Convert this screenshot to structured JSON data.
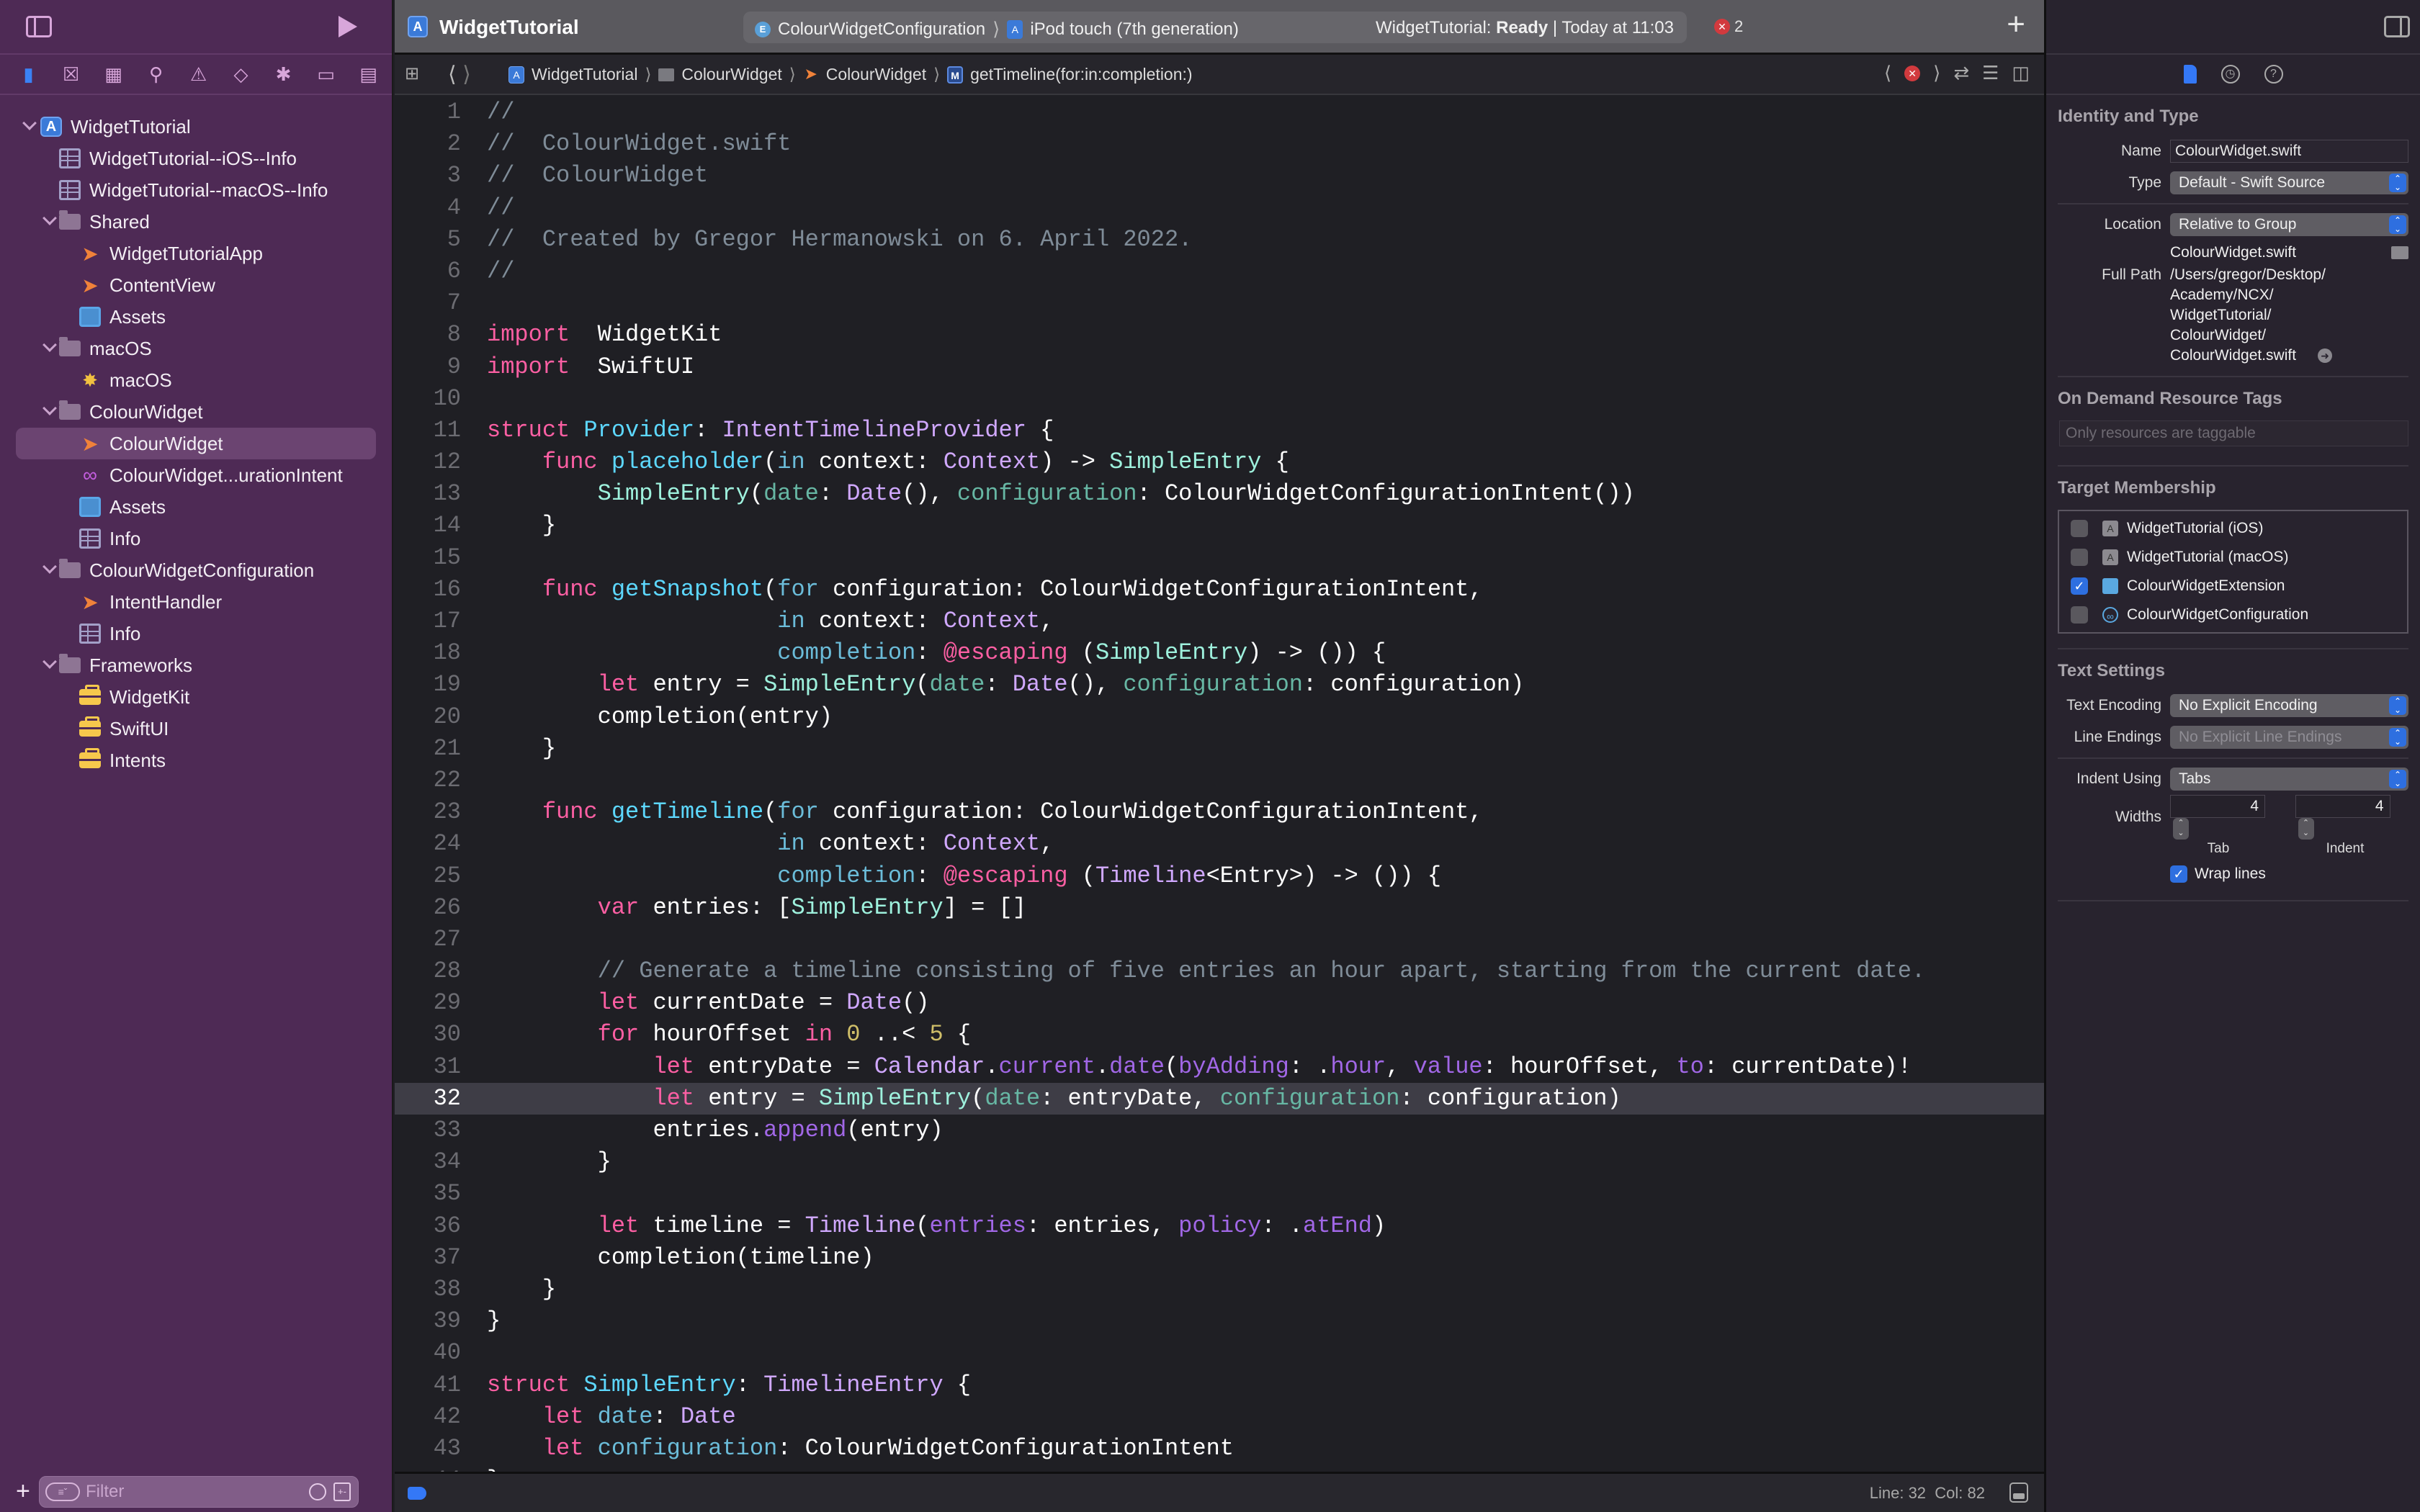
{
  "navigator": {
    "tabs": [
      "project-navigator",
      "source-control-navigator",
      "symbol-navigator",
      "find-navigator",
      "issue-navigator",
      "test-navigator",
      "debug-navigator",
      "breakpoint-navigator",
      "report-navigator"
    ],
    "tree": [
      {
        "label": "WidgetTutorial",
        "icon": "project-icon",
        "depth": 0,
        "expanded": true
      },
      {
        "label": "WidgetTutorial--iOS--Info",
        "icon": "plist-icon",
        "depth": 1
      },
      {
        "label": "WidgetTutorial--macOS--Info",
        "icon": "plist-icon",
        "depth": 1
      },
      {
        "label": "Shared",
        "icon": "folder-icon",
        "depth": 1,
        "expanded": true
      },
      {
        "label": "WidgetTutorialApp",
        "icon": "swift-file-icon",
        "depth": 2
      },
      {
        "label": "ContentView",
        "icon": "swift-file-icon",
        "depth": 2
      },
      {
        "label": "Assets",
        "icon": "asset-catalog-icon",
        "depth": 2
      },
      {
        "label": "macOS",
        "icon": "folder-icon",
        "depth": 1,
        "expanded": true
      },
      {
        "label": "macOS",
        "icon": "entitlements-icon",
        "depth": 2
      },
      {
        "label": "ColourWidget",
        "icon": "folder-icon",
        "depth": 1,
        "expanded": true
      },
      {
        "label": "ColourWidget",
        "icon": "swift-file-icon",
        "depth": 2,
        "selected": true
      },
      {
        "label": "ColourWidget...urationIntent",
        "icon": "intent-definition-icon",
        "depth": 2
      },
      {
        "label": "Assets",
        "icon": "asset-catalog-icon",
        "depth": 2
      },
      {
        "label": "Info",
        "icon": "plist-icon",
        "depth": 2
      },
      {
        "label": "ColourWidgetConfiguration",
        "icon": "folder-icon",
        "depth": 1,
        "expanded": true
      },
      {
        "label": "IntentHandler",
        "icon": "swift-file-icon",
        "depth": 2
      },
      {
        "label": "Info",
        "icon": "plist-icon",
        "depth": 2
      },
      {
        "label": "Frameworks",
        "icon": "folder-icon",
        "depth": 1,
        "expanded": true
      },
      {
        "label": "WidgetKit",
        "icon": "framework-icon",
        "depth": 2
      },
      {
        "label": "SwiftUI",
        "icon": "framework-icon",
        "depth": 2
      },
      {
        "label": "Intents",
        "icon": "framework-icon",
        "depth": 2
      }
    ],
    "filter_placeholder": "Filter"
  },
  "toolbar": {
    "project_title": "WidgetTutorial",
    "scheme": "ColourWidgetConfiguration",
    "destination": "iPod touch (7th generation)",
    "status_prefix": "WidgetTutorial: ",
    "status_state": "Ready",
    "status_time": "| Today at 11:03",
    "error_count": "2"
  },
  "jumpbar": {
    "crumbs": [
      {
        "label": "WidgetTutorial",
        "icon": "project-icon"
      },
      {
        "label": "ColourWidget",
        "icon": "folder-icon"
      },
      {
        "label": "ColourWidget",
        "icon": "swift-file-icon"
      },
      {
        "label": "getTimeline(for:in:completion:)",
        "icon": "method-icon"
      }
    ]
  },
  "editor": {
    "current_line": 32,
    "lines": [
      [
        [
          "cm",
          "//"
        ]
      ],
      [
        [
          "cm",
          "//  ColourWidget.swift"
        ]
      ],
      [
        [
          "cm",
          "//  ColourWidget"
        ]
      ],
      [
        [
          "cm",
          "//"
        ]
      ],
      [
        [
          "cm",
          "//  Created by Gregor Hermanowski on 6. April 2022."
        ]
      ],
      [
        [
          "cm",
          "//"
        ]
      ],
      [],
      [
        [
          "kw",
          "import"
        ],
        [
          "",
          "  WidgetKit"
        ]
      ],
      [
        [
          "kw",
          "import"
        ],
        [
          "",
          "  SwiftUI"
        ]
      ],
      [],
      [
        [
          "kw",
          "struct"
        ],
        [
          "",
          " "
        ],
        [
          "decl",
          "Provider"
        ],
        [
          "",
          ": "
        ],
        [
          "type",
          "IntentTimelineProvider"
        ],
        [
          "",
          " {"
        ]
      ],
      [
        [
          "",
          "    "
        ],
        [
          "kw",
          "func"
        ],
        [
          "",
          " "
        ],
        [
          "decl",
          "placeholder"
        ],
        [
          "",
          "("
        ],
        [
          "lbl",
          "in"
        ],
        [
          "",
          " context: "
        ],
        [
          "type",
          "Context"
        ],
        [
          "",
          ") -> "
        ],
        [
          "proj",
          "SimpleEntry"
        ],
        [
          "",
          " {"
        ]
      ],
      [
        [
          "",
          "        "
        ],
        [
          "proj",
          "SimpleEntry"
        ],
        [
          "",
          "("
        ],
        [
          "param",
          "date"
        ],
        [
          "",
          ": "
        ],
        [
          "type",
          "Date"
        ],
        [
          "",
          "(), "
        ],
        [
          "param",
          "configuration"
        ],
        [
          "",
          ": ColourWidgetConfigurationIntent())"
        ]
      ],
      [
        [
          "",
          "    }"
        ]
      ],
      [],
      [
        [
          "",
          "    "
        ],
        [
          "kw",
          "func"
        ],
        [
          "",
          " "
        ],
        [
          "decl",
          "getSnapshot"
        ],
        [
          "",
          "("
        ],
        [
          "lbl",
          "for"
        ],
        [
          "",
          " configuration: ColourWidgetConfigurationIntent,"
        ]
      ],
      [
        [
          "",
          "                     "
        ],
        [
          "lbl",
          "in"
        ],
        [
          "",
          " context: "
        ],
        [
          "type",
          "Context"
        ],
        [
          "",
          ","
        ]
      ],
      [
        [
          "",
          "                     "
        ],
        [
          "lbl",
          "completion"
        ],
        [
          "",
          ": "
        ],
        [
          "kw",
          "@escaping"
        ],
        [
          "",
          " ("
        ],
        [
          "proj",
          "SimpleEntry"
        ],
        [
          "",
          ") -> ()) {"
        ]
      ],
      [
        [
          "",
          "        "
        ],
        [
          "kw",
          "let"
        ],
        [
          "",
          " entry = "
        ],
        [
          "proj",
          "SimpleEntry"
        ],
        [
          "",
          "("
        ],
        [
          "param",
          "date"
        ],
        [
          "",
          ": "
        ],
        [
          "type",
          "Date"
        ],
        [
          "",
          "(), "
        ],
        [
          "param",
          "configuration"
        ],
        [
          "",
          ": configuration)"
        ]
      ],
      [
        [
          "",
          "        completion(entry)"
        ]
      ],
      [
        [
          "",
          "    }"
        ]
      ],
      [],
      [
        [
          "",
          "    "
        ],
        [
          "kw",
          "func"
        ],
        [
          "",
          " "
        ],
        [
          "decl",
          "getTimeline"
        ],
        [
          "",
          "("
        ],
        [
          "lbl",
          "for"
        ],
        [
          "",
          " configuration: ColourWidgetConfigurationIntent,"
        ]
      ],
      [
        [
          "",
          "                     "
        ],
        [
          "lbl",
          "in"
        ],
        [
          "",
          " context: "
        ],
        [
          "type",
          "Context"
        ],
        [
          "",
          ","
        ]
      ],
      [
        [
          "",
          "                     "
        ],
        [
          "lbl",
          "completion"
        ],
        [
          "",
          ": "
        ],
        [
          "kw",
          "@escaping"
        ],
        [
          "",
          " ("
        ],
        [
          "type",
          "Timeline"
        ],
        [
          "",
          "<Entry>) -> ()) {"
        ]
      ],
      [
        [
          "",
          "        "
        ],
        [
          "kw",
          "var"
        ],
        [
          "",
          " entries: ["
        ],
        [
          "proj",
          "SimpleEntry"
        ],
        [
          "",
          "] = []"
        ]
      ],
      [],
      [
        [
          "",
          "        "
        ],
        [
          "cm",
          "// Generate a timeline consisting of five entries an hour apart, starting from the current date."
        ]
      ],
      [
        [
          "",
          "        "
        ],
        [
          "kw",
          "let"
        ],
        [
          "",
          " currentDate = "
        ],
        [
          "type",
          "Date"
        ],
        [
          "",
          "()"
        ]
      ],
      [
        [
          "",
          "        "
        ],
        [
          "kw",
          "for"
        ],
        [
          "",
          " hourOffset "
        ],
        [
          "kw",
          "in"
        ],
        [
          "",
          " "
        ],
        [
          "num",
          "0"
        ],
        [
          "",
          " ..< "
        ],
        [
          "num",
          "5"
        ],
        [
          "",
          " {"
        ]
      ],
      [
        [
          "",
          "            "
        ],
        [
          "kw",
          "let"
        ],
        [
          "",
          " entryDate = "
        ],
        [
          "type",
          "Calendar"
        ],
        [
          "",
          "."
        ],
        [
          "api",
          "current"
        ],
        [
          "",
          "."
        ],
        [
          "api",
          "date"
        ],
        [
          "",
          "("
        ],
        [
          "api",
          "byAdding"
        ],
        [
          "",
          ": ."
        ],
        [
          "api",
          "hour"
        ],
        [
          "",
          ", "
        ],
        [
          "api",
          "value"
        ],
        [
          "",
          ": hourOffset, "
        ],
        [
          "api",
          "to"
        ],
        [
          "",
          ": currentDate)!"
        ]
      ],
      [
        [
          "",
          "            "
        ],
        [
          "kw",
          "let"
        ],
        [
          "",
          " entry = "
        ],
        [
          "proj",
          "SimpleEntry"
        ],
        [
          "",
          "("
        ],
        [
          "param",
          "date"
        ],
        [
          "",
          ": entryDate, "
        ],
        [
          "param",
          "configuration"
        ],
        [
          "",
          ": configuration)"
        ]
      ],
      [
        [
          "",
          "            entries."
        ],
        [
          "api",
          "append"
        ],
        [
          "",
          "(entry)"
        ]
      ],
      [
        [
          "",
          "        }"
        ]
      ],
      [],
      [
        [
          "",
          "        "
        ],
        [
          "kw",
          "let"
        ],
        [
          "",
          " timeline = "
        ],
        [
          "type",
          "Timeline"
        ],
        [
          "",
          "("
        ],
        [
          "api",
          "entries"
        ],
        [
          "",
          ": entries, "
        ],
        [
          "api",
          "policy"
        ],
        [
          "",
          ": ."
        ],
        [
          "api",
          "atEnd"
        ],
        [
          "",
          ")"
        ]
      ],
      [
        [
          "",
          "        completion(timeline)"
        ]
      ],
      [
        [
          "",
          "    }"
        ]
      ],
      [
        [
          "",
          "}"
        ]
      ],
      [],
      [
        [
          "kw",
          "struct"
        ],
        [
          "",
          " "
        ],
        [
          "decl",
          "SimpleEntry"
        ],
        [
          "",
          ": "
        ],
        [
          "type",
          "TimelineEntry"
        ],
        [
          "",
          " {"
        ]
      ],
      [
        [
          "",
          "    "
        ],
        [
          "kw",
          "let"
        ],
        [
          "",
          " "
        ],
        [
          "lbl",
          "date"
        ],
        [
          "",
          ": "
        ],
        [
          "type",
          "Date"
        ]
      ],
      [
        [
          "",
          "    "
        ],
        [
          "kw",
          "let"
        ],
        [
          "",
          " "
        ],
        [
          "lbl",
          "configuration"
        ],
        [
          "",
          ": ColourWidgetConfigurationIntent"
        ]
      ],
      [
        [
          "",
          "}"
        ]
      ]
    ],
    "status": {
      "line_label": "Line: 32",
      "col_label": "Col: 82"
    }
  },
  "inspector": {
    "identity": {
      "title": "Identity and Type",
      "name_label": "Name",
      "name_value": "ColourWidget.swift",
      "type_label": "Type",
      "type_value": "Default - Swift Source",
      "location_label": "Location",
      "location_value": "Relative to Group",
      "file_name": "ColourWidget.swift",
      "full_path_label": "Full Path",
      "full_path_lines": [
        "/Users/gregor/Desktop/",
        "Academy/NCX/",
        "WidgetTutorial/",
        "ColourWidget/",
        "ColourWidget.swift"
      ]
    },
    "odr": {
      "title": "On Demand Resource Tags",
      "placeholder": "Only resources are taggable"
    },
    "target_membership": {
      "title": "Target Membership",
      "targets": [
        {
          "label": "WidgetTutorial (iOS)",
          "checked": false,
          "icon": "app-target-icon"
        },
        {
          "label": "WidgetTutorial (macOS)",
          "checked": false,
          "icon": "app-target-icon"
        },
        {
          "label": "ColourWidgetExtension",
          "checked": true,
          "icon": "widget-extension-icon"
        },
        {
          "label": "ColourWidgetConfiguration",
          "checked": false,
          "icon": "intents-extension-icon"
        }
      ]
    },
    "text_settings": {
      "title": "Text Settings",
      "encoding_label": "Text Encoding",
      "encoding_value": "No Explicit Encoding",
      "line_endings_label": "Line Endings",
      "line_endings_value": "No Explicit Line Endings",
      "indent_label": "Indent Using",
      "indent_value": "Tabs",
      "widths_label": "Widths",
      "tab_width": "4",
      "indent_width": "4",
      "tab_caption": "Tab",
      "indent_caption": "Indent",
      "wrap_label": "Wrap lines",
      "wrap_checked": true
    }
  }
}
